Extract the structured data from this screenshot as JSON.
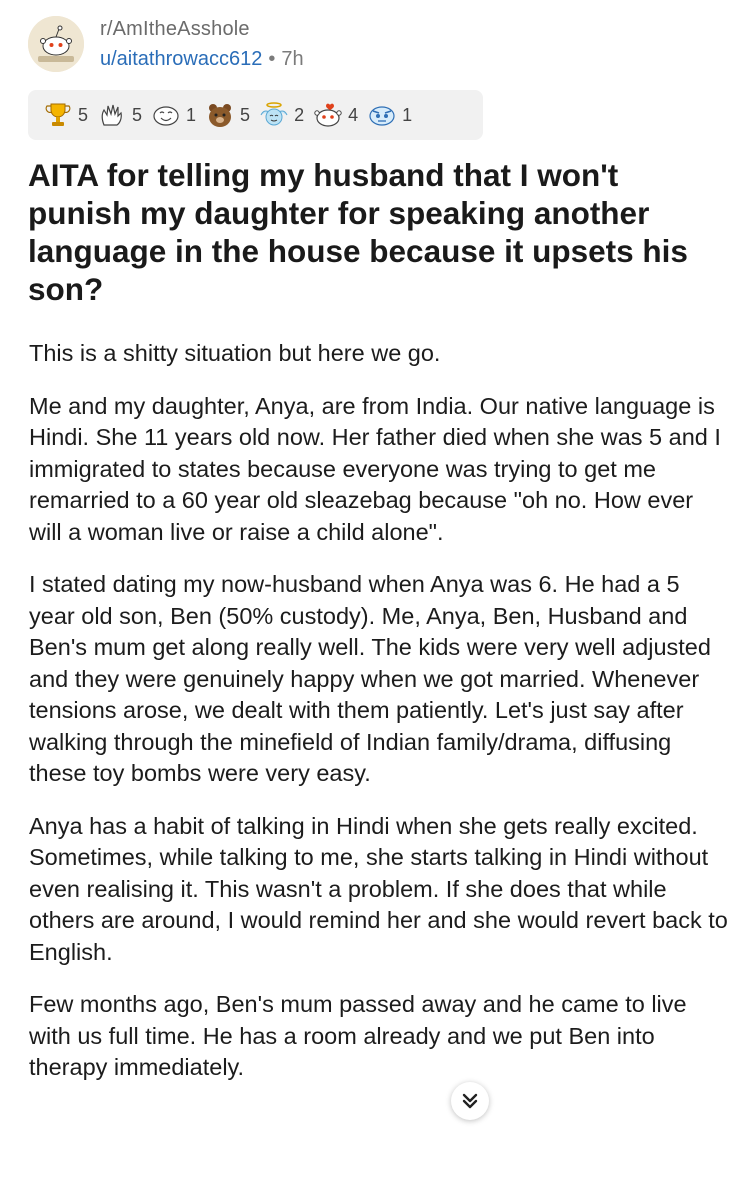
{
  "post": {
    "subreddit": "r/AmItheAsshole",
    "author": "u/aitathrowacc612",
    "separator": "•",
    "age": "7h",
    "awards": [
      {
        "icon": "gold-trophy-icon",
        "count": "5"
      },
      {
        "icon": "wholesome-hands-icon",
        "count": "5"
      },
      {
        "icon": "laughing-face-icon",
        "count": "1"
      },
      {
        "icon": "bear-hug-icon",
        "count": "5"
      },
      {
        "icon": "angel-face-icon",
        "count": "2"
      },
      {
        "icon": "snoo-heart-icon",
        "count": "4"
      },
      {
        "icon": "blue-face-icon",
        "count": "1"
      }
    ],
    "title": "AITA for telling my husband that I won't punish my daughter for speaking another language in the house because it upsets his son?",
    "paragraphs": [
      "This is a shitty situation but here we go.",
      "Me and my daughter, Anya, are from India. Our native language is Hindi. She 11 years old now. Her father died when she was 5 and I immigrated to states because everyone was trying to get me remarried to a 60 year old sleazebag because \"oh no. How ever will a woman live or raise a child alone\".",
      "I stated dating my now-husband when Anya was 6. He had a 5 year old son, Ben (50% custody). Me, Anya, Ben, Husband and Ben's mum get along really well. The kids were very well adjusted and they were genuinely happy when we got married. Whenever tensions arose, we dealt with them patiently. Let's just say after walking through the minefield of Indian family/drama, diffusing these toy bombs were very easy.",
      "Anya has a habit of talking in Hindi when she gets really excited. Sometimes, while talking to me, she starts talking in Hindi without even realising it. This wasn't a problem. If she does that while others are around, I would remind her and she would revert back to English.",
      "Few months ago, Ben's mum passed away and he came to live with us full time. He has a room already and we put Ben into therapy immediately."
    ]
  },
  "colors": {
    "user_link": "#2a6db8",
    "meta_gray": "#7b7b7b",
    "award_bar": "#f1f1f1"
  },
  "scroll_button": {
    "icon": "double-chevron-down-icon"
  }
}
